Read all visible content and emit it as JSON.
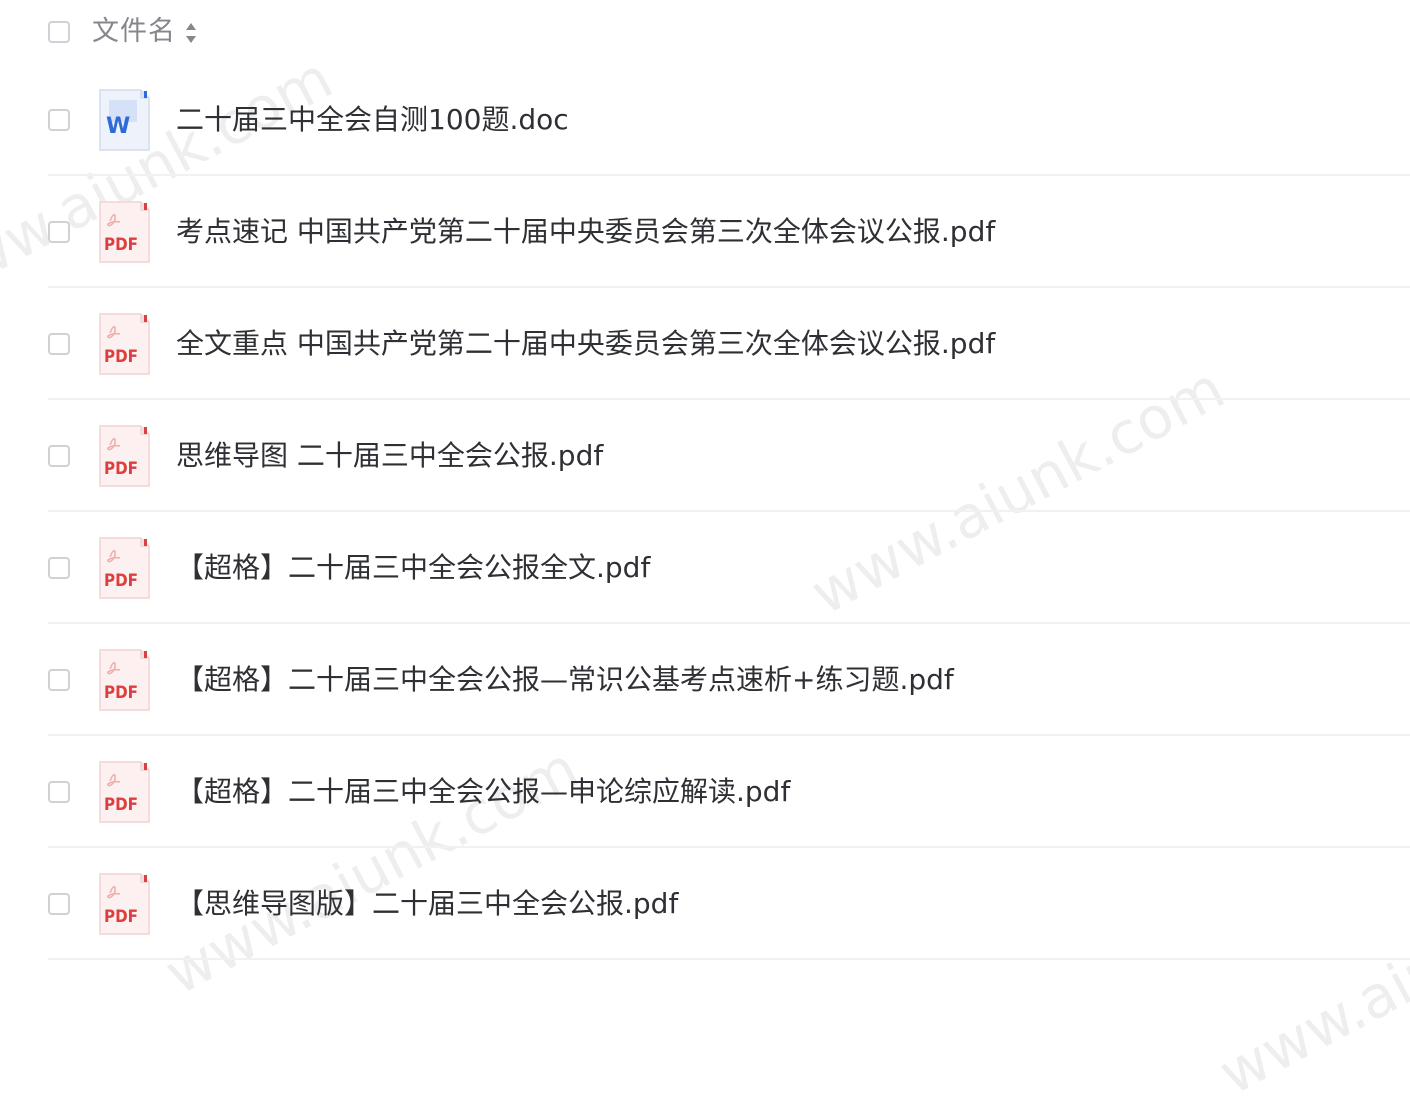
{
  "header": {
    "column_label": "文件名",
    "sort_icon": "sort-up-down-icon"
  },
  "files": [
    {
      "name": "二十届三中全会自测100题.doc",
      "type": "doc",
      "icon": "word-doc-icon"
    },
    {
      "name": "考点速记 中国共产党第二十届中央委员会第三次全体会议公报.pdf",
      "type": "pdf",
      "icon": "pdf-file-icon"
    },
    {
      "name": "全文重点 中国共产党第二十届中央委员会第三次全体会议公报.pdf",
      "type": "pdf",
      "icon": "pdf-file-icon"
    },
    {
      "name": "思维导图 二十届三中全会公报.pdf",
      "type": "pdf",
      "icon": "pdf-file-icon"
    },
    {
      "name": "【超格】二十届三中全会公报全文.pdf",
      "type": "pdf",
      "icon": "pdf-file-icon"
    },
    {
      "name": "【超格】二十届三中全会公报—常识公基考点速析+练习题.pdf",
      "type": "pdf",
      "icon": "pdf-file-icon"
    },
    {
      "name": "【超格】二十届三中全会公报—申论综应解读.pdf",
      "type": "pdf",
      "icon": "pdf-file-icon"
    },
    {
      "name": "【思维导图版】二十届三中全会公报.pdf",
      "type": "pdf",
      "icon": "pdf-file-icon"
    }
  ],
  "icon_labels": {
    "doc": "W",
    "pdf": "PDF"
  },
  "watermark": {
    "text": "www.aiunk.com"
  },
  "colors": {
    "pdf_red": "#d9403f",
    "doc_blue": "#2f6bd8",
    "text": "#2f3035",
    "muted": "#85878d"
  }
}
